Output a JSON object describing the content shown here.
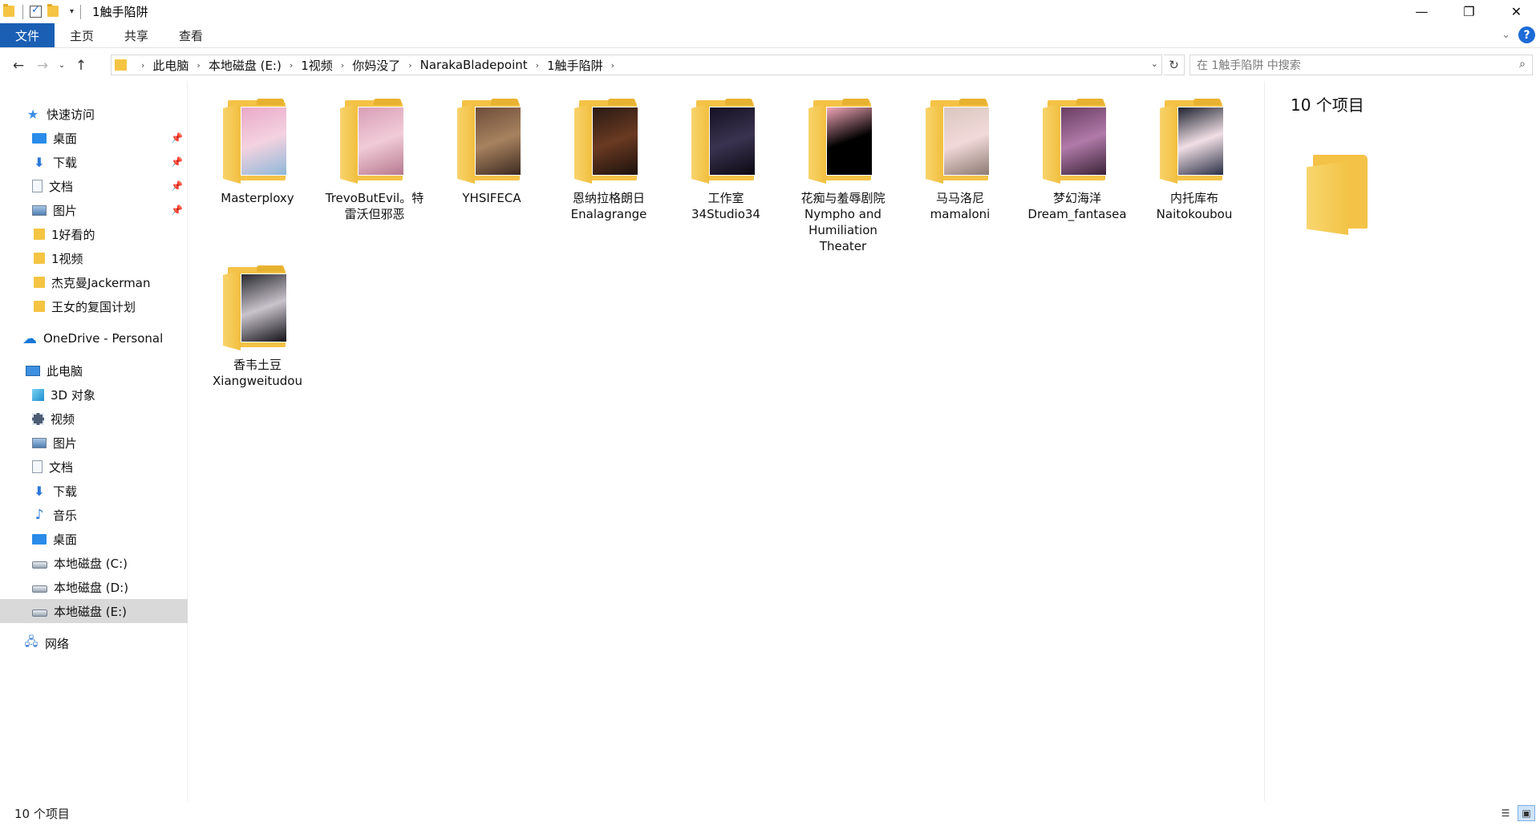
{
  "window": {
    "title": "1触手陷阱",
    "qa_down": "▾"
  },
  "winbtns": {
    "min": "—",
    "max": "❐",
    "close": "✕"
  },
  "ribbon": {
    "tabs": [
      "文件",
      "主页",
      "共享",
      "查看"
    ],
    "expand": "⌄",
    "help": "?"
  },
  "nav": {
    "back": "←",
    "forward": "→",
    "recent": "⌄",
    "up": "↑",
    "sep": "›",
    "crumbs": [
      "此电脑",
      "本地磁盘 (E:)",
      "1视频",
      "你妈没了",
      "NarakaBladepoint",
      "1触手陷阱"
    ],
    "addr_drop": "⌄",
    "refresh": "↻",
    "search_placeholder": "在 1触手陷阱 中搜索",
    "search_icon": "⌕"
  },
  "sidebar": {
    "pin": "📌",
    "quick_access": {
      "label": "快速访问",
      "icon": "star-icon"
    },
    "quick_items": [
      {
        "label": "桌面",
        "icon": "desktop-icon",
        "pinned": true
      },
      {
        "label": "下载",
        "icon": "download-icon",
        "pinned": true
      },
      {
        "label": "文档",
        "icon": "document-icon",
        "pinned": true
      },
      {
        "label": "图片",
        "icon": "picture-icon",
        "pinned": true
      },
      {
        "label": "1好看的",
        "icon": "folder-icon",
        "pinned": false
      },
      {
        "label": "1视频",
        "icon": "folder-icon",
        "pinned": false
      },
      {
        "label": "杰克曼Jackerman",
        "icon": "folder-icon",
        "pinned": false
      },
      {
        "label": "王女的复国计划",
        "icon": "folder-icon",
        "pinned": false
      }
    ],
    "onedrive": {
      "label": "OneDrive - Personal",
      "icon": "cloud-icon"
    },
    "this_pc": {
      "label": "此电脑",
      "icon": "computer-icon"
    },
    "pc_items": [
      {
        "label": "3D 对象",
        "icon": "3d-objects-icon"
      },
      {
        "label": "视频",
        "icon": "video-icon"
      },
      {
        "label": "图片",
        "icon": "picture-icon"
      },
      {
        "label": "文档",
        "icon": "document-icon"
      },
      {
        "label": "下载",
        "icon": "download-icon"
      },
      {
        "label": "音乐",
        "icon": "music-icon"
      },
      {
        "label": "桌面",
        "icon": "desktop-icon"
      },
      {
        "label": "本地磁盘 (C:)",
        "icon": "drive-icon"
      },
      {
        "label": "本地磁盘 (D:)",
        "icon": "drive-icon"
      },
      {
        "label": "本地磁盘 (E:)",
        "icon": "drive-icon",
        "selected": true
      }
    ],
    "network": {
      "label": "网络",
      "icon": "network-icon"
    }
  },
  "folders": [
    {
      "name": "Masterploxy",
      "colors": [
        "#e9a9c9",
        "#f4d2e0",
        "#8fb8d8"
      ]
    },
    {
      "name": "TrevoButEvil。特雷沃但邪恶",
      "colors": [
        "#d99fb6",
        "#f1cbd8",
        "#b7798f"
      ]
    },
    {
      "name": "YHSIFECA",
      "colors": [
        "#6e4e3b",
        "#a7825f",
        "#3c2a20"
      ]
    },
    {
      "name": "恩纳拉格朗日Enalagrange",
      "colors": [
        "#2a1a14",
        "#6a3a22",
        "#1b110c"
      ]
    },
    {
      "name": "工作室34Studio34",
      "colors": [
        "#151022",
        "#3a3350",
        "#0b0812"
      ]
    },
    {
      "name": "花痴与羞辱剧院Nympho and Humiliation Theater",
      "colors": [
        "#f0a5b6",
        "#000000",
        "#000000"
      ]
    },
    {
      "name": "马马洛尼mamaloni",
      "colors": [
        "#d9c7c0",
        "#f2d9d9",
        "#8c7a72"
      ]
    },
    {
      "name": "梦幻海洋Dream_fantasea",
      "colors": [
        "#6a3e64",
        "#b07aa8",
        "#3b2338"
      ]
    },
    {
      "name": "内托库布Naitokoubou",
      "colors": [
        "#1e2230",
        "#f1dfe5",
        "#2a2f45"
      ]
    },
    {
      "name": "香韦土豆Xiangweitudou",
      "colors": [
        "#2a2a30",
        "#c9c3cc",
        "#111116"
      ]
    }
  ],
  "preview": {
    "count": "10 个项目"
  },
  "status": {
    "count": "10 个项目",
    "details_view": "☰",
    "large_icons_view": "▣"
  }
}
